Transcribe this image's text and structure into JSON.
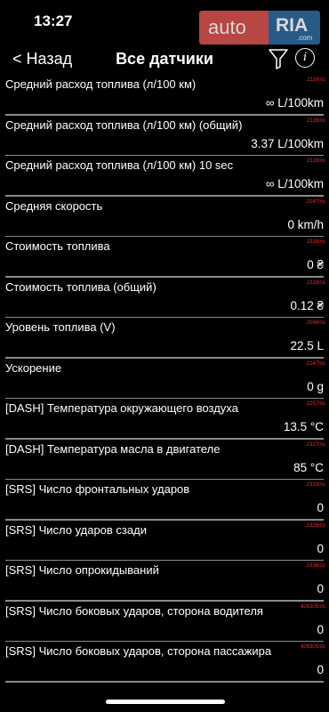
{
  "status_bar": {
    "time": "13:27"
  },
  "watermark": {
    "auto": "auto",
    "ria": "RIA",
    "com": ".com"
  },
  "nav": {
    "back_label": "< Назад",
    "title": "Все датчики",
    "info_glyph": "i"
  },
  "sensors": [
    {
      "label": "Средний расход топлива (л/100 км)",
      "value": "∞ L/100km",
      "ms": "2116ms"
    },
    {
      "label": "Средний расход топлива (л/100 км) (общий)",
      "value": "3.37 L/100km",
      "ms": "2116ms"
    },
    {
      "label": "Средний расход топлива (л/100 км) 10 sec",
      "value": "∞ L/100km",
      "ms": "2116ms"
    },
    {
      "label": "Средняя скорость",
      "value": "0 km/h",
      "ms": "2147ms"
    },
    {
      "label": "Стоимость топлива",
      "value": "0 ₴",
      "ms": "2116ms"
    },
    {
      "label": "Стоимость топлива (общий)",
      "value": "0.12 ₴",
      "ms": "2116ms"
    },
    {
      "label": "Уровень топлива (V)",
      "value": "22.5 L",
      "ms": "2096ms"
    },
    {
      "label": "Ускорение",
      "value": "0 g",
      "ms": "2147ms"
    },
    {
      "label": "[DASH] Температура окружающего воздуха",
      "value": "13.5 °C",
      "ms": "2257ms"
    },
    {
      "label": "[DASH] Температура масла в двигателе",
      "value": "85 °C",
      "ms": "2317ms"
    },
    {
      "label": "[SRS] Число фронтальных ударов",
      "value": "0",
      "ms": "2315ms"
    },
    {
      "label": "[SRS] Число ударов сзади",
      "value": "0",
      "ms": "2326ms"
    },
    {
      "label": "[SRS] Число опрокидываний",
      "value": "0",
      "ms": "2336ms"
    },
    {
      "label": "[SRS] Число боковых ударов, сторона водителя",
      "value": "0",
      "ms": "428305ms"
    },
    {
      "label": "[SRS] Число боковых ударов, сторона пассажира",
      "value": "0",
      "ms": "428305ms"
    }
  ]
}
